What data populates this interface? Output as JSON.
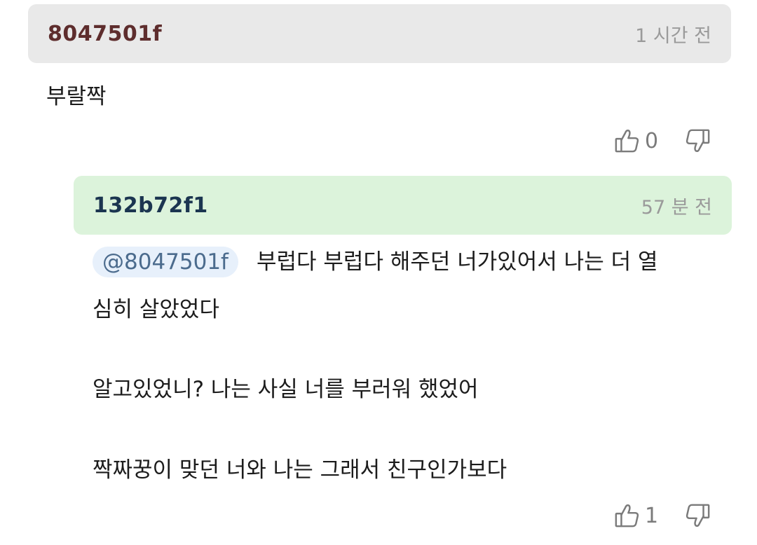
{
  "comments": [
    {
      "author": "8047501f",
      "time": "1 시간 전",
      "text": "부랄짝",
      "likes": "0"
    },
    {
      "author": "132b72f1",
      "time": "57 분 전",
      "mention": "@8047501f",
      "line1": "부럽다 부럽다 해주던 너가있어서 나는 더 열",
      "line2": "심히 살았었다",
      "line3": "알고있었니? 나는 사실 너를 부러워 했었어",
      "line4": "짝짜꿍이 맞던 너와 나는 그래서 친구인가보다",
      "likes": "1"
    }
  ]
}
